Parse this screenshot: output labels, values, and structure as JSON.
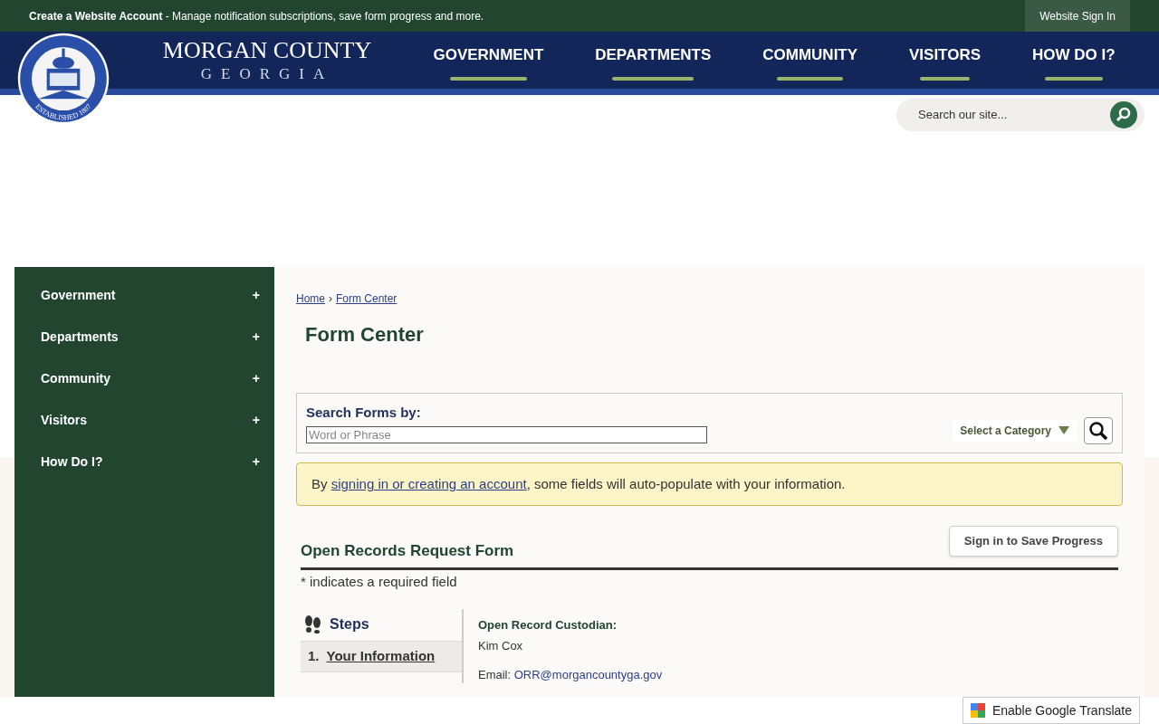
{
  "top_bar": {
    "account_link": "Create a Website Account",
    "account_text": " - Manage notification subscriptions, save form progress and more.",
    "sign_in": "Website Sign In"
  },
  "header": {
    "site_name": "MORGAN COUNTY",
    "site_subtitle": "GEORGIA",
    "seal_bottom": "ESTABLISHED 1807",
    "nav": [
      {
        "label": "GOVERNMENT"
      },
      {
        "label": "DEPARTMENTS"
      },
      {
        "label": "COMMUNITY"
      },
      {
        "label": "VISITORS"
      },
      {
        "label": "HOW DO I?"
      }
    ],
    "search": {
      "placeholder": "Search our site..."
    }
  },
  "sidebar": {
    "items": [
      {
        "label": "Government",
        "expander": "+"
      },
      {
        "label": "Departments",
        "expander": "+"
      },
      {
        "label": "Community",
        "expander": "+"
      },
      {
        "label": "Visitors",
        "expander": "+"
      },
      {
        "label": "How Do I?",
        "expander": "+"
      }
    ]
  },
  "breadcrumb": [
    {
      "label": "Home"
    },
    {
      "label": "Form Center"
    }
  ],
  "breadcrumb_separator": "›",
  "page_title": "Form Center",
  "form_search": {
    "heading": "Search Forms by:",
    "placeholder": "Word or Phrase",
    "category": "Select a Category"
  },
  "notice": {
    "before": "By ",
    "link": "signing in or creating an account",
    "after": ", some fields will auto-populate with your information."
  },
  "form": {
    "title": "Open Records Request Form",
    "save_button": "Sign in to Save Progress",
    "required_note": "* indicates a required field",
    "steps_heading": "Steps",
    "steps": [
      {
        "number": "1.",
        "label": "Your Information",
        "selected": true
      }
    ],
    "custodian_label": "Open Record Custodian:",
    "custodian_name": "Kim Cox",
    "email_label": "Email: ",
    "email": "ORR@morgancountyga.gov"
  },
  "translate": {
    "label": "Enable Google Translate"
  }
}
